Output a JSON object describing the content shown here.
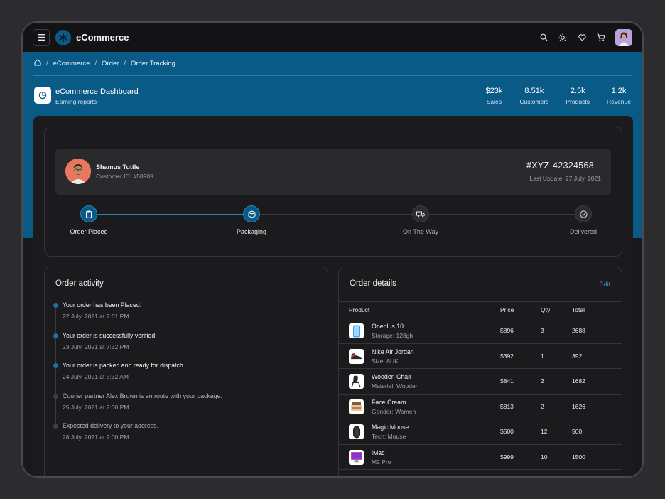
{
  "app": {
    "title": "eCommerce",
    "menu_icon": "hamburger-icon",
    "logo_icon": "snowflake-logo-icon"
  },
  "topbar": {
    "icons": [
      "search-icon",
      "sun-icon",
      "heart-icon",
      "cart-icon"
    ]
  },
  "breadcrumb": [
    "eCommerce",
    "Order",
    "Order Tracking"
  ],
  "dashboard": {
    "title": "eCommerce Dashboard",
    "subtitle": "Earning reports",
    "stats": [
      {
        "value": "$23k",
        "label": "Sales"
      },
      {
        "value": "8.51k",
        "label": "Customers"
      },
      {
        "value": "2.5k",
        "label": "Products"
      },
      {
        "value": "1.2k",
        "label": "Revenue"
      }
    ]
  },
  "customer": {
    "name": "Shamus Tuttle",
    "id": "Customer ID: #58909",
    "order_number": "#XYZ-42324568",
    "last_update": "Last Update: 27 July, 2021"
  },
  "steps": [
    {
      "label": "Order Placed",
      "state": "done",
      "icon": "clipboard-icon"
    },
    {
      "label": "Packaging",
      "state": "done",
      "icon": "box-icon"
    },
    {
      "label": "On The Way",
      "state": "pending",
      "icon": "truck-icon"
    },
    {
      "label": "Delivered",
      "state": "pending",
      "icon": "check-circle-icon"
    }
  ],
  "activity": {
    "title": "Order activity",
    "items": [
      {
        "text": "Your order has been Placed.",
        "date": "22 July, 2021 at 2:61 PM",
        "done": true
      },
      {
        "text": "Your order is successfully verified.",
        "date": "23 July, 2021 at 7:32 PM",
        "done": true
      },
      {
        "text": "Your order is packed and ready for dispatch.",
        "date": "24 July, 2021 at 5:32 AM",
        "done": true
      },
      {
        "text": "Courier partner Alex Brown is en route with your package.",
        "date": "25 July, 2021 at 2:00 PM",
        "done": false
      },
      {
        "text": "Expected delivery to your address.",
        "date": "28 July, 2021 at 2:00 PM",
        "done": false
      }
    ]
  },
  "details": {
    "title": "Order details",
    "edit_label": "Edit",
    "columns": [
      "Product",
      "Price",
      "Qty",
      "Total"
    ],
    "rows": [
      {
        "name": "Oneplus 10",
        "sub": "Storage: 128gb",
        "price": "$896",
        "qty": "3",
        "total": "2688",
        "thumb": "phone-thumb"
      },
      {
        "name": "Nike Air Jordan",
        "sub": "Size: 8UK",
        "price": "$392",
        "qty": "1",
        "total": "392",
        "thumb": "shoe-thumb"
      },
      {
        "name": "Wooden Chair",
        "sub": "Material: Wooden",
        "price": "$841",
        "qty": "2",
        "total": "1682",
        "thumb": "chair-thumb"
      },
      {
        "name": "Face Cream",
        "sub": "Gender: Women",
        "price": "$813",
        "qty": "2",
        "total": "1626",
        "thumb": "cream-thumb"
      },
      {
        "name": "Magic Mouse",
        "sub": "Tech: Mouse",
        "price": "$500",
        "qty": "12",
        "total": "500",
        "thumb": "mouse-thumb"
      },
      {
        "name": "iMac",
        "sub": "M2 Pro",
        "price": "$999",
        "qty": "10",
        "total": "1500",
        "thumb": "imac-thumb"
      }
    ]
  },
  "colors": {
    "accent": "#0a5a88",
    "link": "#2b8bd0",
    "background": "#19191b"
  }
}
